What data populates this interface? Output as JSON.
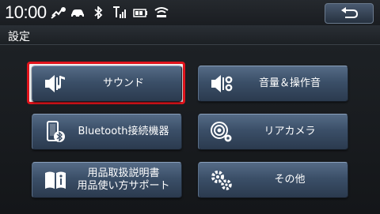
{
  "status": {
    "time": "10:00",
    "icons": [
      "gps-icon",
      "car-icon",
      "bluetooth-icon",
      "signal-icon",
      "battery-icon",
      "wifi-icon"
    ]
  },
  "header": {
    "back_icon": "return-arrow-icon",
    "title": "設定"
  },
  "menu": {
    "items": [
      {
        "label": "サウンド",
        "icon": "speaker-music-icon",
        "selected": true
      },
      {
        "label": "音量＆操作音",
        "icon": "speaker-gear-icon"
      },
      {
        "label": "Bluetooth接続機器",
        "icon": "phone-bluetooth-icon"
      },
      {
        "label": "リアカメラ",
        "icon": "camera-gear-icon"
      },
      {
        "label": "用品取扱説明書\n用品使い方サポート",
        "icon": "manual-book-icon"
      },
      {
        "label": "その他",
        "icon": "gears-icon"
      }
    ]
  },
  "colors": {
    "selection": "#e0141c",
    "button": "#3b4f68"
  }
}
